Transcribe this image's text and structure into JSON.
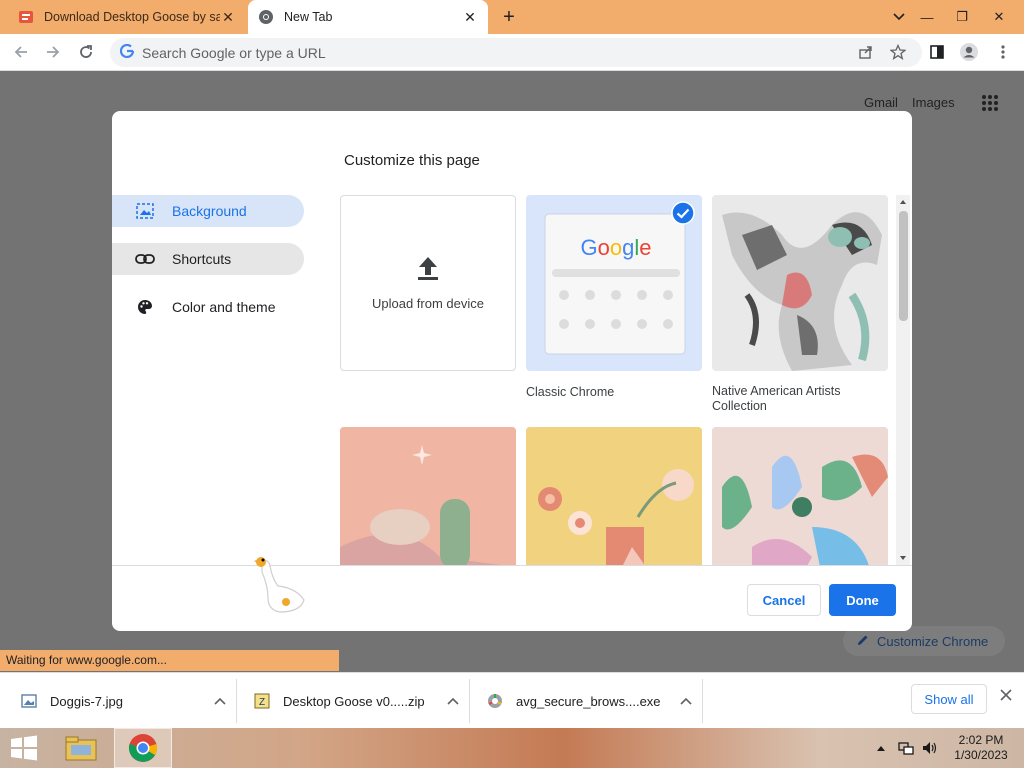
{
  "tabs": [
    {
      "title": "Download Desktop Goose by sa",
      "close": "✕"
    },
    {
      "title": "New Tab",
      "close": "✕"
    }
  ],
  "new_tab_symbol": "+",
  "window_controls": {
    "minimize": "—",
    "restore": "❐",
    "close": "✕"
  },
  "omnibox": {
    "placeholder": "Search Google or type a URL"
  },
  "top_links": {
    "gmail": "Gmail",
    "images": "Images"
  },
  "customize_chrome": "Customize Chrome",
  "dialog": {
    "title": "Customize this page",
    "nav": [
      {
        "label": "Background",
        "icon": "image-icon"
      },
      {
        "label": "Shortcuts",
        "icon": "link-icon"
      },
      {
        "label": "Color and theme",
        "icon": "palette-icon"
      }
    ],
    "upload_label": "Upload from device",
    "tiles": [
      {
        "label": "Classic Chrome"
      },
      {
        "label": "Native American Artists Collection"
      }
    ],
    "cancel": "Cancel",
    "done": "Done"
  },
  "status_text": "Waiting for www.google.com...",
  "downloads": [
    {
      "name": "Doggis-7.jpg",
      "icon": "image-file-icon"
    },
    {
      "name": "Desktop Goose v0.....zip",
      "icon": "zip-file-icon"
    },
    {
      "name": "avg_secure_brows....exe",
      "icon": "installer-icon"
    }
  ],
  "show_all": "Show all",
  "clock": {
    "time": "2:02 PM",
    "date": "1/30/2023"
  },
  "colors": {
    "accent": "#1a73e8",
    "tabbar": "#f2ac6b",
    "nav_active": "#d8e4f8"
  }
}
